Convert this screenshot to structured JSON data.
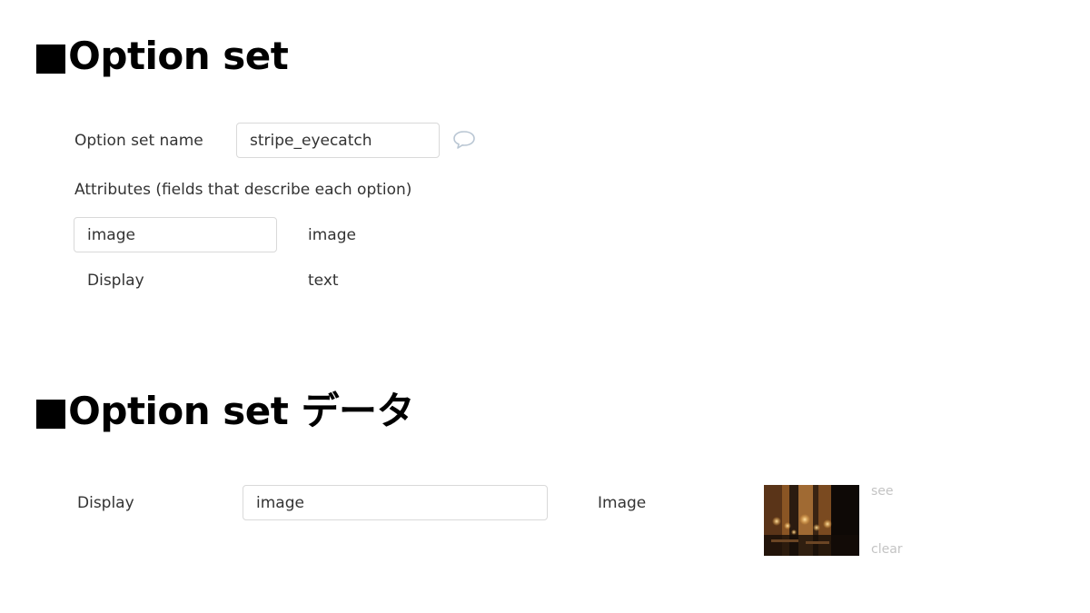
{
  "section1": {
    "heading": "■Option set",
    "name_label": "Option set name",
    "name_value": "stripe_eyecatch",
    "comment_icon": "speech-bubble-icon",
    "attributes_label": "Attributes (fields that describe each option)",
    "attributes": [
      {
        "name": "image",
        "type": "image",
        "editable": true
      },
      {
        "name": "Display",
        "type": "text",
        "editable": false
      }
    ]
  },
  "section2": {
    "heading": "■Option set データ",
    "display_label": "Display",
    "display_value": "image",
    "image_label": "Image",
    "see_link": "see",
    "clear_link": "clear"
  },
  "colors": {
    "heading": "#000000",
    "text": "#333333",
    "input_border": "#d9d9d9",
    "muted_link": "#c4c4c4",
    "icon": "#b9c6d3"
  }
}
